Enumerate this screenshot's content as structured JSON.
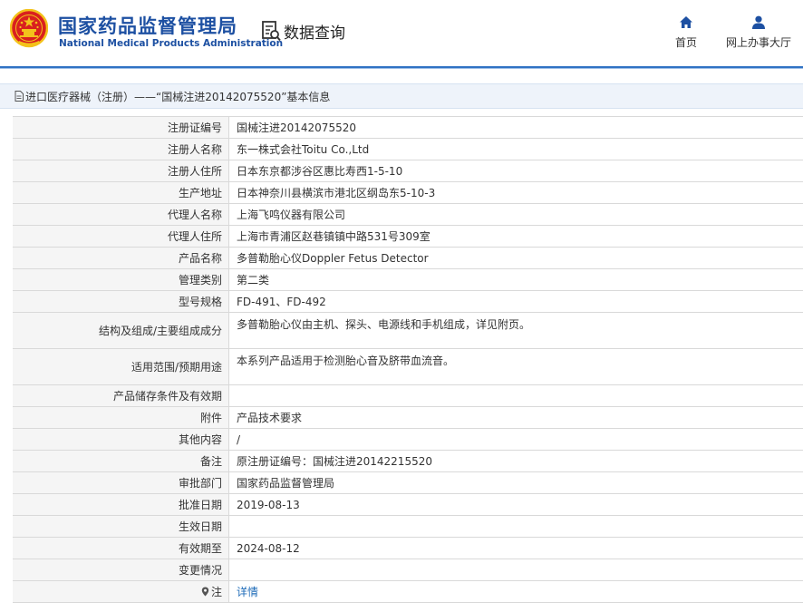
{
  "header": {
    "org_name_cn": "国家药品监督管理局",
    "org_name_en": "National Medical Products Administration",
    "query_label": "数据查询",
    "nav": {
      "home_label": "首页",
      "hall_label": "网上办事大厅"
    }
  },
  "breadcrumb": {
    "text": "进口医疗器械（注册）——“国械注进20142075520”基本信息"
  },
  "details": [
    {
      "key": "注册证编号",
      "value": "国械注进20142075520"
    },
    {
      "key": "注册人名称",
      "value": "东一株式会社Toitu Co.,Ltd"
    },
    {
      "key": "注册人住所",
      "value": "日本东京都涉谷区惠比寿西1-5-10"
    },
    {
      "key": "生产地址",
      "value": "日本神奈川县横滨市港北区纲岛东5-10-3"
    },
    {
      "key": "代理人名称",
      "value": "上海飞鸣仪器有限公司"
    },
    {
      "key": "代理人住所",
      "value": "上海市青浦区赵巷镇镇中路531号309室"
    },
    {
      "key": "产品名称",
      "value": "多普勒胎心仪Doppler Fetus Detector"
    },
    {
      "key": "管理类别",
      "value": "第二类"
    },
    {
      "key": "型号规格",
      "value": "FD-491、FD-492"
    },
    {
      "key": "结构及组成/主要组成成分",
      "value": "多普勒胎心仪由主机、探头、电源线和手机组成，详见附页。"
    },
    {
      "key": "适用范围/预期用途",
      "value": "本系列产品适用于检测胎心音及脐带血流音。"
    },
    {
      "key": "产品储存条件及有效期",
      "value": ""
    },
    {
      "key": "附件",
      "value": "产品技术要求"
    },
    {
      "key": "其他内容",
      "value": "/"
    },
    {
      "key": "备注",
      "value": "原注册证编号：国械注进20142215520"
    },
    {
      "key": "审批部门",
      "value": "国家药品监督管理局"
    },
    {
      "key": "批准日期",
      "value": "2019-08-13"
    },
    {
      "key": "生效日期",
      "value": ""
    },
    {
      "key": "有效期至",
      "value": "2024-08-12"
    },
    {
      "key": "变更情况",
      "value": ""
    },
    {
      "key": "注",
      "value": "详情"
    }
  ],
  "colors": {
    "brand_blue": "#1d50a2",
    "link_blue": "#1e6bb8",
    "emblem_red": "#d9201f",
    "emblem_gold": "#f3c21b"
  }
}
